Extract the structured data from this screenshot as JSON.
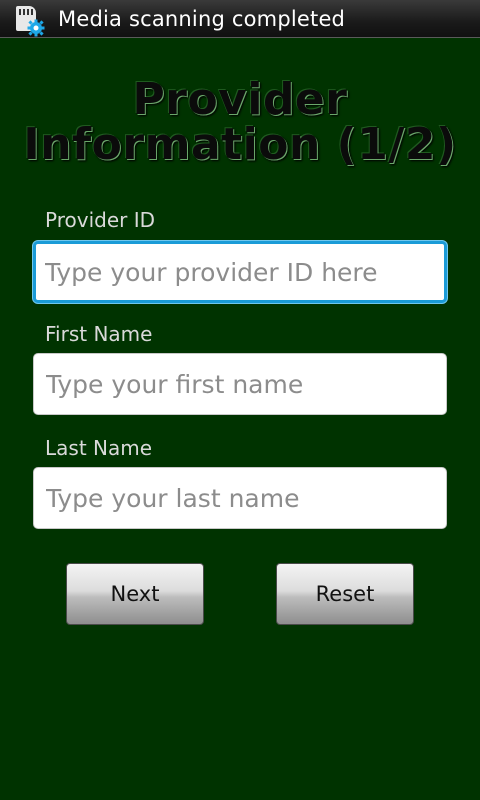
{
  "status_bar": {
    "notification_text": "Media scanning completed",
    "icon": "sd-card-scan-icon"
  },
  "form": {
    "title_line1": "Provider",
    "title_line2": "Information (1/2)",
    "fields": [
      {
        "label": "Provider ID",
        "value": "",
        "placeholder": "Type your provider ID here",
        "focused": true
      },
      {
        "label": "First Name",
        "value": "",
        "placeholder": "Type your first name",
        "focused": false
      },
      {
        "label": "Last Name",
        "value": "",
        "placeholder": "Type your last name",
        "focused": false
      }
    ],
    "buttons": {
      "next": "Next",
      "reset": "Reset"
    }
  },
  "colors": {
    "background": "#003300",
    "focus_border": "#1a9bd7",
    "status_bar": "#1a1a1a"
  }
}
